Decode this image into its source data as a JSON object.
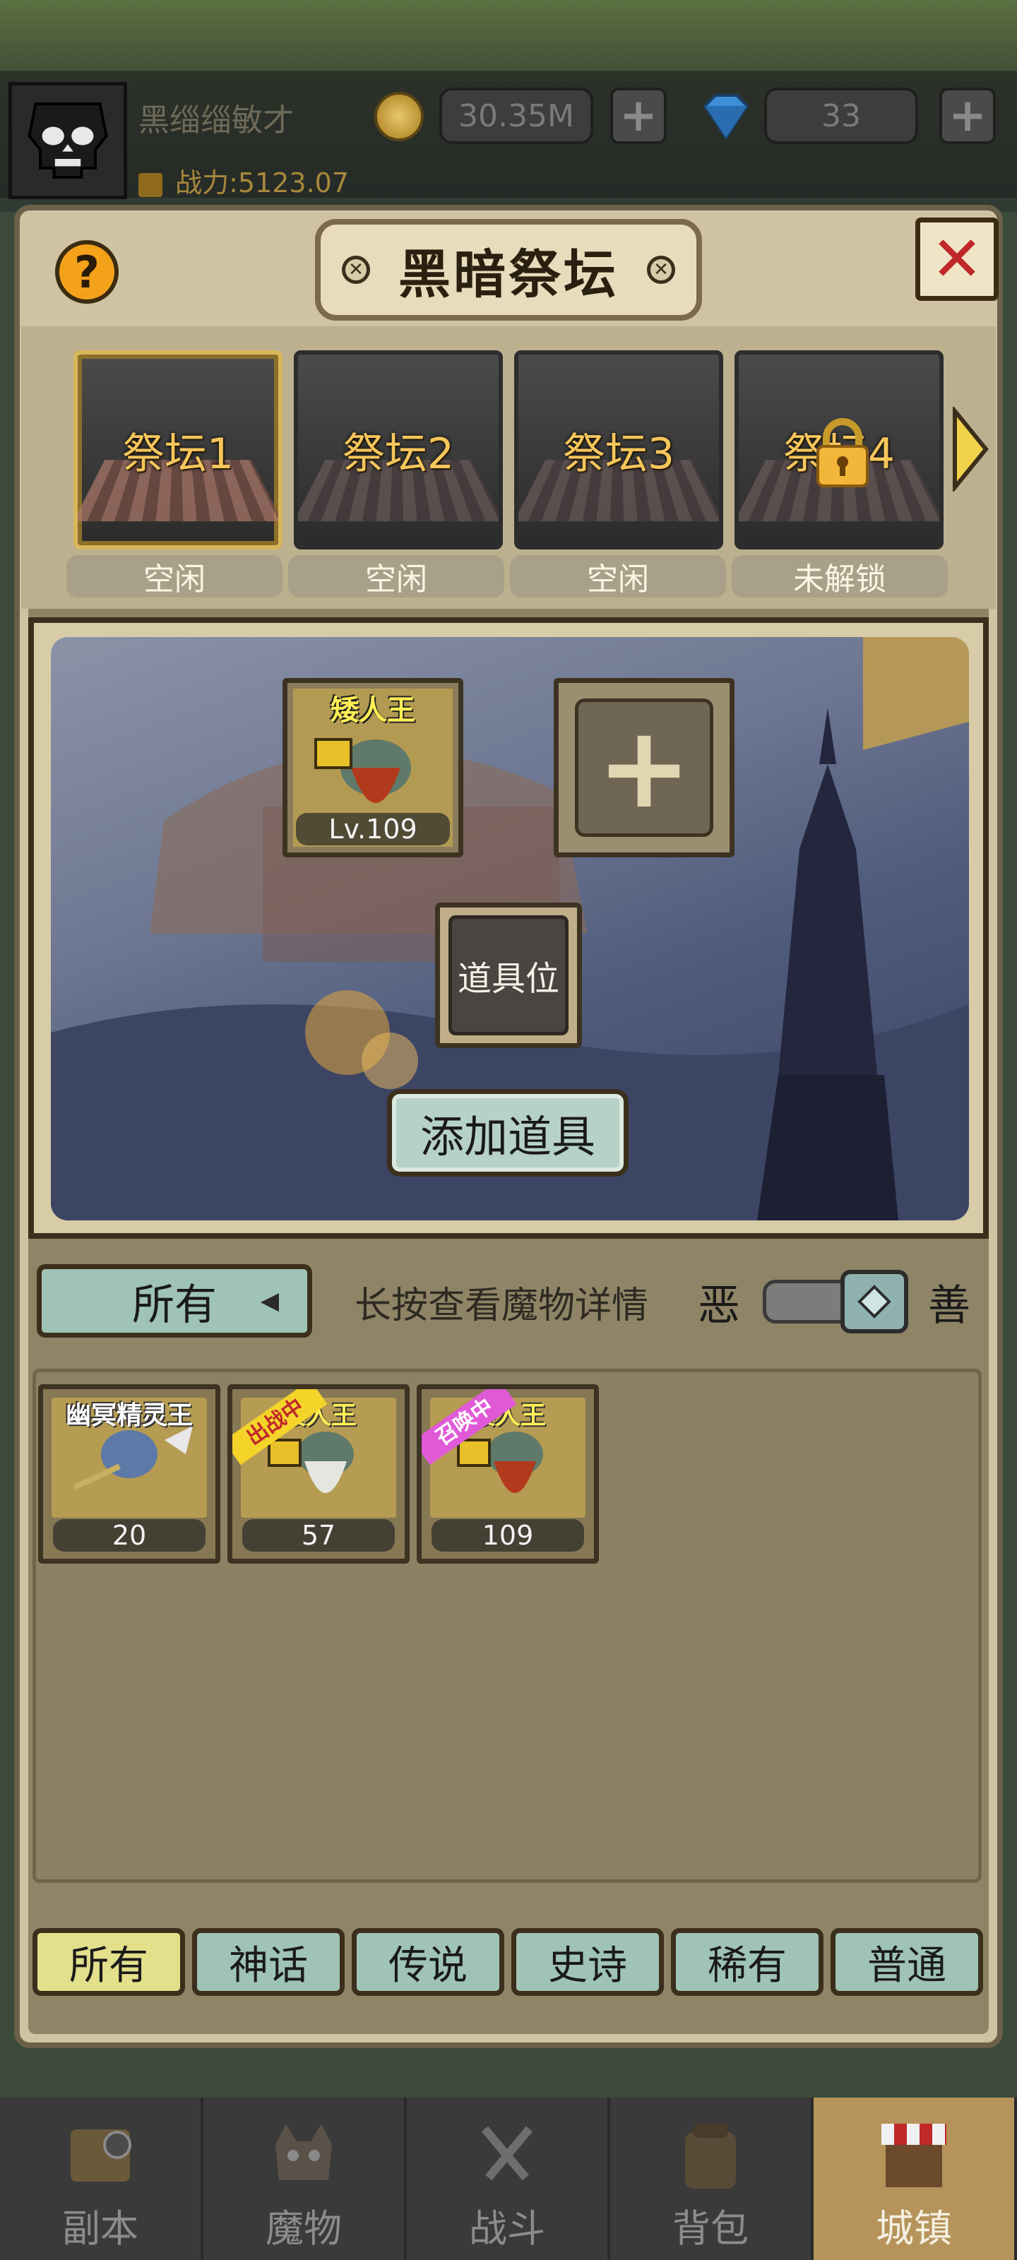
{
  "header": {
    "username": "黑缁缁敏才",
    "gold": "30.35M",
    "gems": "33",
    "power": "战力:5123.07",
    "plus_label": "+"
  },
  "panel": {
    "title": "黑暗祭坛",
    "help_label": "?",
    "close_label": "✕"
  },
  "altars": [
    {
      "label": "祭坛1",
      "status": "空闲",
      "active": true,
      "locked": false
    },
    {
      "label": "祭坛2",
      "status": "空闲",
      "active": false,
      "locked": false
    },
    {
      "label": "祭坛3",
      "status": "空闲",
      "active": false,
      "locked": false
    },
    {
      "label": "祭坛4",
      "status": "未解锁",
      "active": false,
      "locked": true
    }
  ],
  "scene": {
    "slot_hero": {
      "name": "矮人王",
      "level": "Lv.109"
    },
    "add_slot_label": "+",
    "prop_slot_label": "道具位",
    "add_prop_button": "添加道具"
  },
  "filter": {
    "all_label": "所有",
    "arrow": "◀",
    "hint": "长按查看魔物详情",
    "evil_label": "恶",
    "good_label": "善"
  },
  "inventory": [
    {
      "name": "幽冥精灵王",
      "level": "20",
      "badge": "",
      "badge_color": ""
    },
    {
      "name": "矮人王",
      "level": "57",
      "badge": "出战中",
      "badge_color": "#f5d42a"
    },
    {
      "name": "矮人王",
      "level": "109",
      "badge": "召唤中",
      "badge_color": "#e05ad8"
    }
  ],
  "rarity_tabs": [
    {
      "label": "所有",
      "active": true
    },
    {
      "label": "神话",
      "active": false
    },
    {
      "label": "传说",
      "active": false
    },
    {
      "label": "史诗",
      "active": false
    },
    {
      "label": "稀有",
      "active": false
    },
    {
      "label": "普通",
      "active": false
    }
  ],
  "bottom_nav": [
    {
      "label": "副本",
      "icon": "map-icon",
      "active": false
    },
    {
      "label": "魔物",
      "icon": "monster-icon",
      "active": false
    },
    {
      "label": "战斗",
      "icon": "swords-icon",
      "active": false
    },
    {
      "label": "背包",
      "icon": "backpack-icon",
      "active": false
    },
    {
      "label": "城镇",
      "icon": "town-icon",
      "active": true
    }
  ],
  "colors": {
    "accent_gold": "#f6c65b",
    "active_tab": "#e3e08c",
    "tab": "#9fc3b4",
    "close_red": "#c0282a"
  }
}
